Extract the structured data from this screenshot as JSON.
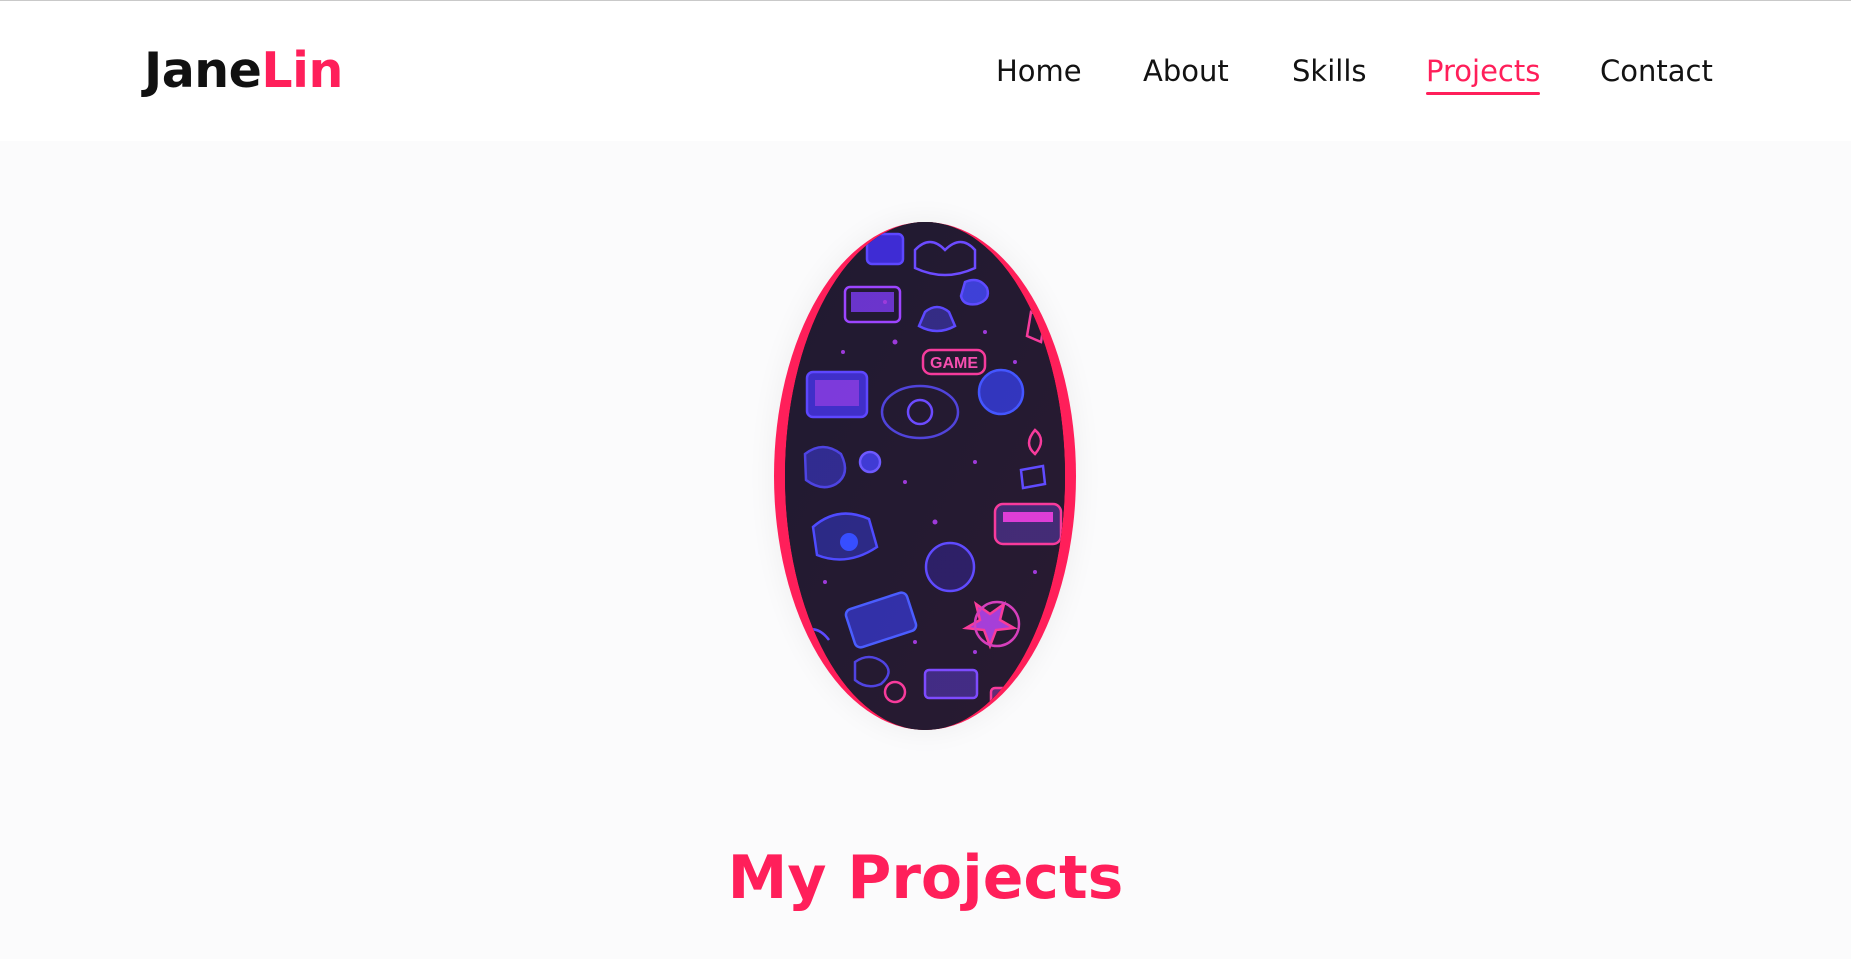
{
  "brand": {
    "first": "Jane",
    "last": "Lin",
    "accent_color": "#ff1f5a"
  },
  "nav": {
    "items": [
      {
        "label": "Home"
      },
      {
        "label": "About"
      },
      {
        "label": "Skills"
      },
      {
        "label": "Projects",
        "active": true
      },
      {
        "label": "Contact"
      }
    ]
  },
  "hero": {
    "image": "gaming-pattern-illustration",
    "badge_text": "GAME"
  },
  "section": {
    "title": "My Projects"
  }
}
